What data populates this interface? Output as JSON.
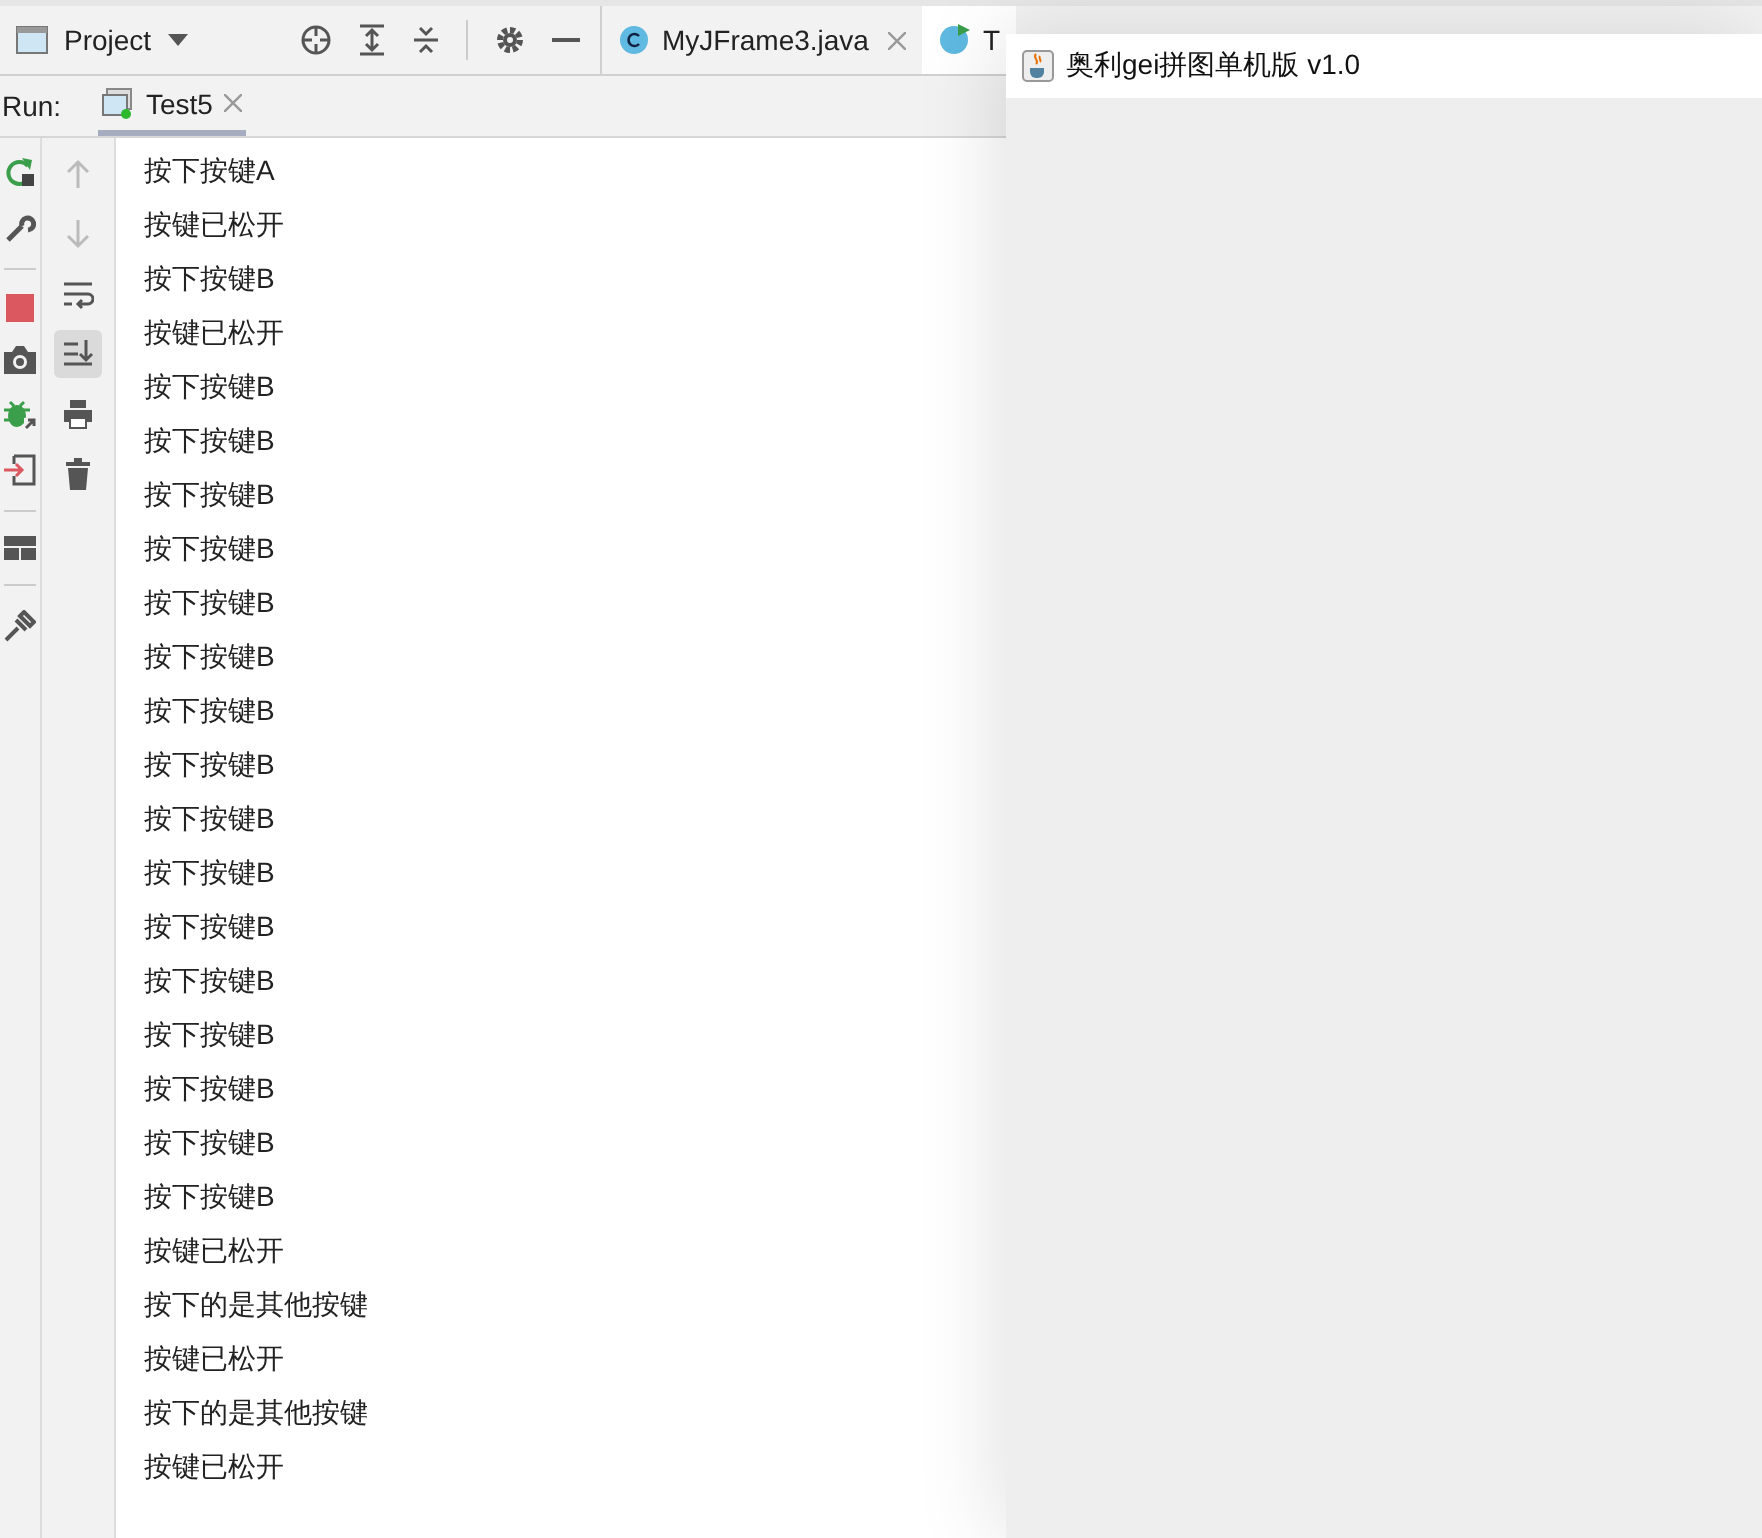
{
  "project_panel": {
    "title": "Project"
  },
  "editor_tabs": [
    {
      "label": "MyJFrame3.java",
      "selected": false,
      "kind": "class"
    },
    {
      "label": "T",
      "selected": true,
      "kind": "run"
    }
  ],
  "run_panel": {
    "label": "Run:",
    "tabs": [
      {
        "label": "Test5",
        "selected": true
      }
    ]
  },
  "console_toolbar": [
    {
      "kind": "up",
      "disabled": true
    },
    {
      "kind": "down",
      "disabled": true
    },
    {
      "kind": "wrap",
      "disabled": false,
      "selected": false
    },
    {
      "kind": "scroll-end",
      "disabled": false,
      "selected": true
    },
    {
      "kind": "print",
      "disabled": false,
      "selected": false
    },
    {
      "kind": "trash",
      "disabled": false,
      "selected": false
    }
  ],
  "console_lines": [
    "按下按键A",
    "按键已松开",
    "按下按键B",
    "按键已松开",
    "按下按键B",
    "按下按键B",
    "按下按键B",
    "按下按键B",
    "按下按键B",
    "按下按键B",
    "按下按键B",
    "按下按键B",
    "按下按键B",
    "按下按键B",
    "按下按键B",
    "按下按键B",
    "按下按键B",
    "按下按键B",
    "按下按键B",
    "按下按键B",
    "按键已松开",
    "按下的是其他按键",
    "按键已松开",
    "按下的是其他按键",
    "按键已松开"
  ],
  "app_window": {
    "title": "奥利gei拼图单机版 v1.0"
  }
}
